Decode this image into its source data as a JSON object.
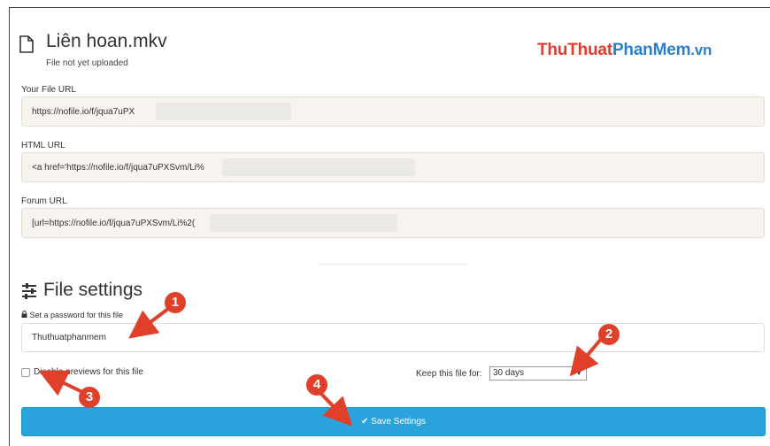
{
  "file": {
    "title": "Liên hoan.mkv",
    "status": "File not yet uploaded"
  },
  "watermark": {
    "part1": "ThuThuat",
    "part2": "PhanMem",
    "part3": ".vn"
  },
  "links": {
    "file_url_label": "Your File URL",
    "file_url_value": "https://nofile.io/f/jqua7uPX",
    "html_url_label": "HTML URL",
    "html_url_value": "<a href='https://nofile.io/f/jqua7uPXSvm/Li%",
    "forum_url_label": "Forum URL",
    "forum_url_value": "[url=https://nofile.io/f/jqua7uPXSvm/Li%2("
  },
  "settings": {
    "title": "File settings",
    "password_label": "Set a password for this file",
    "password_value": "Thuthuatphanmem",
    "disable_previews_label": "Disable previews for this file",
    "keep_label": "Keep this file for:",
    "keep_value": "30 days",
    "save_label": "Save Settings"
  },
  "annotations": {
    "b1": "1",
    "b2": "2",
    "b3": "3",
    "b4": "4"
  },
  "colors": {
    "accent_button": "#2aa3dd",
    "annotation_red": "#e0402a"
  }
}
